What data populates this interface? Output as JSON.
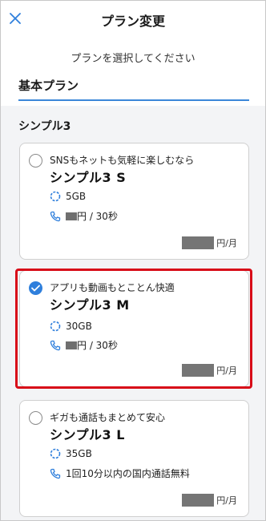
{
  "header": {
    "title": "プラン変更",
    "close_icon": "close-icon"
  },
  "subtitle": "プランを選択してください",
  "tab": {
    "label": "基本プラン"
  },
  "section": {
    "title": "シンプル3"
  },
  "colors": {
    "accent": "#2f7fdc",
    "selected_outline": "#d80c18"
  },
  "plans": [
    {
      "tagline": "SNSもネットも気軽に楽しむなら",
      "name": "シンプル3 S",
      "data": "5GB",
      "call": "円 / 30秒",
      "price_unit": "円/月",
      "selected": false
    },
    {
      "tagline": "アプリも動画もとことん快適",
      "name": "シンプル3 M",
      "data": "30GB",
      "call": "円 / 30秒",
      "price_unit": "円/月",
      "selected": true
    },
    {
      "tagline": "ギガも通話もまとめて安心",
      "name": "シンプル3 L",
      "data": "35GB",
      "call": "1回10分以内の国内通話無料",
      "price_unit": "円/月",
      "selected": false
    }
  ]
}
